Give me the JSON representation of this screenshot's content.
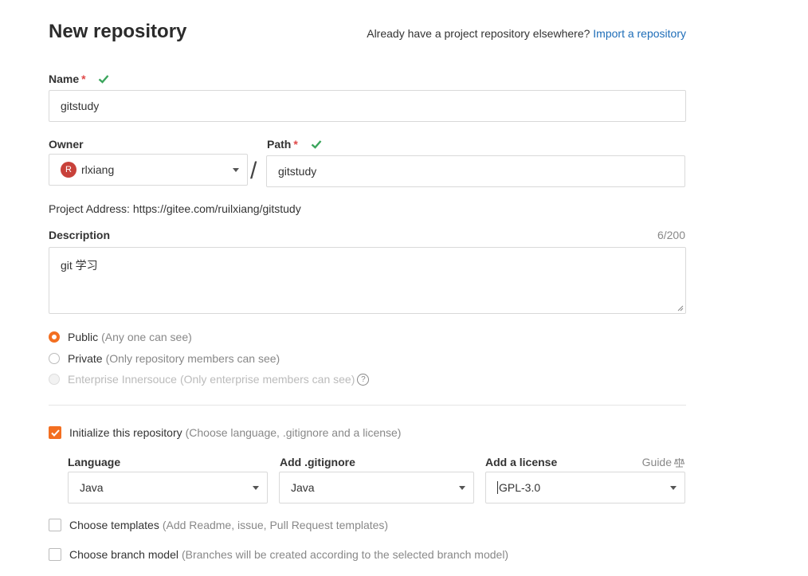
{
  "page": {
    "title": "New repository",
    "import_prompt": "Already have a project repository elsewhere?",
    "import_link": "Import a repository"
  },
  "name": {
    "label": "Name",
    "required_mark": "*",
    "value": "gitstudy"
  },
  "owner": {
    "label": "Owner",
    "avatar_letter": "R",
    "value": "rlxiang"
  },
  "separator": "/",
  "path": {
    "label": "Path",
    "required_mark": "*",
    "value": "gitstudy"
  },
  "project_address": "Project Address: https://gitee.com/ruilxiang/gitstudy",
  "description": {
    "label": "Description",
    "counter": "6/200",
    "value": "git 学习"
  },
  "visibility": [
    {
      "label": "Public",
      "hint": "(Any one can see)",
      "state": "selected"
    },
    {
      "label": "Private",
      "hint": "(Only repository members can see)",
      "state": "unselected"
    },
    {
      "label": "Enterprise Innersouce",
      "hint": "(Only enterprise members can see)",
      "state": "disabled",
      "help": "?"
    }
  ],
  "initialize": {
    "label": "Initialize this repository",
    "hint": "(Choose language, .gitignore and a license)",
    "checked": true
  },
  "language": {
    "label": "Language",
    "value": "Java"
  },
  "gitignore": {
    "label": "Add .gitignore",
    "value": "Java"
  },
  "license": {
    "label": "Add a license",
    "value": "GPL-3.0",
    "guide": "Guide"
  },
  "templates": {
    "label": "Choose templates",
    "hint": "(Add Readme, issue, Pull Request templates)",
    "checked": false
  },
  "branch_model": {
    "label": "Choose branch model",
    "hint": "(Branches will be created according to the selected branch model)",
    "checked": false
  },
  "colors": {
    "accent": "#f36f21",
    "link": "#1e6db8",
    "success": "#3ba55c",
    "required": "#e04848"
  }
}
